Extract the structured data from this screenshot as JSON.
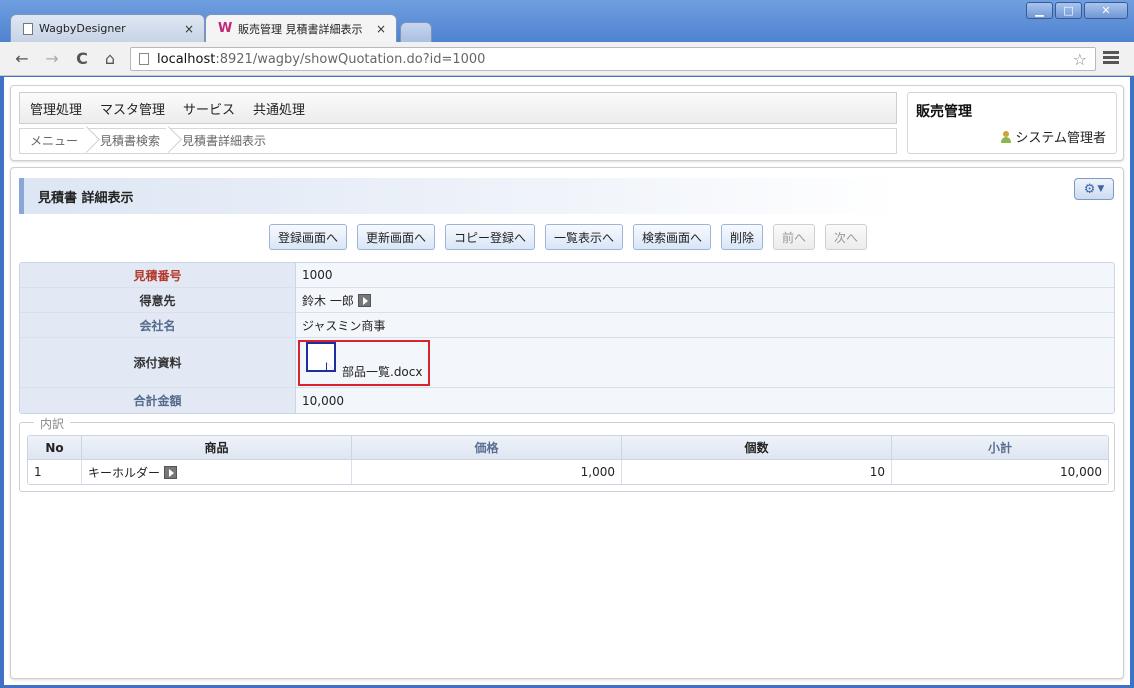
{
  "browser": {
    "tabs": [
      {
        "label": "WagbyDesigner",
        "close": "×"
      },
      {
        "label": "販売管理 見積書詳細表示",
        "close": "×"
      }
    ],
    "window_buttons": {
      "minimize": "▁",
      "maximize": "□",
      "close": "✕"
    },
    "nav": {
      "back": "←",
      "forward": "→",
      "reload": "C",
      "home": "⌂"
    },
    "url_host": "localhost",
    "url_rest": ":8921/wagby/showQuotation.do?id=1000",
    "star": "☆"
  },
  "header": {
    "menu": [
      "管理処理",
      "マスタ管理",
      "サービス",
      "共通処理"
    ],
    "breadcrumb": [
      "メニュー",
      "見積書検索",
      "見積書詳細表示"
    ],
    "app_title": "販売管理",
    "user": "システム管理者"
  },
  "section": {
    "title": "見積書 詳細表示",
    "gear": "⚙",
    "caret": "▼"
  },
  "actions": {
    "register": "登録画面へ",
    "update": "更新画面へ",
    "copy": "コピー登録へ",
    "list": "一覧表示へ",
    "search": "検索画面へ",
    "delete": "削除",
    "prev": "前へ",
    "next": "次へ"
  },
  "detail": {
    "quote_no_label": "見積番号",
    "quote_no": "1000",
    "customer_label": "得意先",
    "customer": "鈴木 一郎",
    "company_label": "会社名",
    "company": "ジャスミン商事",
    "attachment_label": "添付資料",
    "attachment_file": "部品一覧.docx",
    "total_label": "合計金額",
    "total": "10,000"
  },
  "items": {
    "legend": "内訳",
    "headers": {
      "no": "No",
      "product": "商品",
      "price": "価格",
      "qty": "個数",
      "subtotal": "小計"
    },
    "rows": [
      {
        "no": "1",
        "product": "キーホルダー",
        "price": "1,000",
        "qty": "10",
        "subtotal": "10,000"
      }
    ]
  },
  "colors": {
    "required_label": "#b33a2a",
    "highlight_box": "#d9232e",
    "file_icon": "#1b2fa0"
  }
}
